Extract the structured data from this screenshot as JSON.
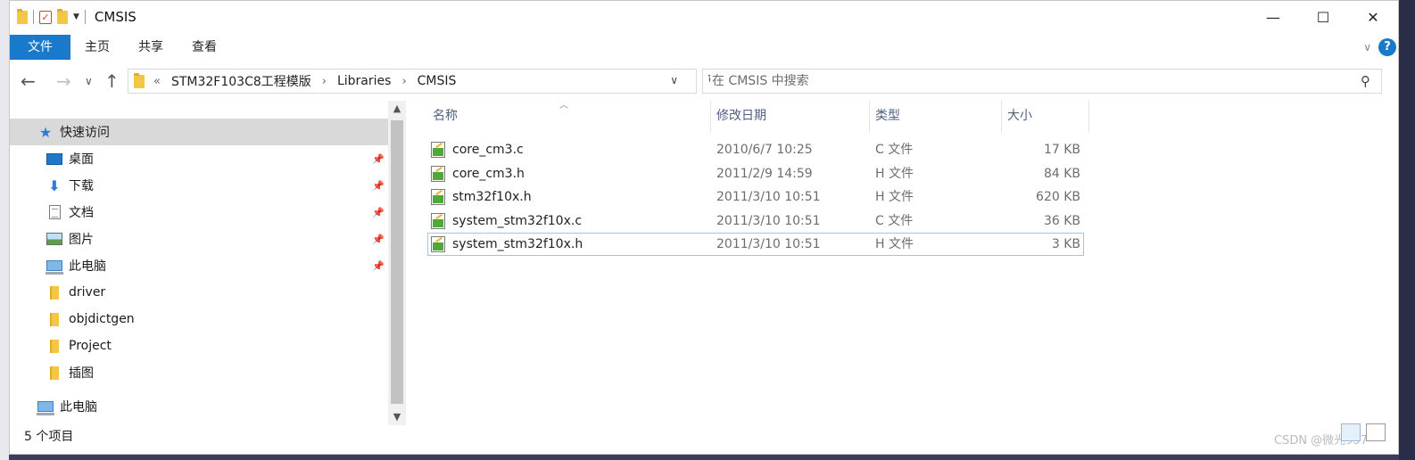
{
  "window": {
    "title": "CMSIS",
    "minimize": "—",
    "maximize": "☐",
    "close": "✕"
  },
  "ribbon": {
    "tabs": [
      "文件",
      "主页",
      "共享",
      "查看"
    ],
    "help": "?",
    "expand": "∨"
  },
  "nav": {
    "back": "←",
    "forward": "→",
    "recent": "∨",
    "up": "↑"
  },
  "address": {
    "prefix": "«",
    "crumbs": [
      "STM32F103C8工程模版",
      "Libraries",
      "CMSIS"
    ],
    "sep": "›",
    "dropdown": "∨",
    "refresh": "↻"
  },
  "search": {
    "placeholder": "在 CMSIS 中搜索",
    "value": "",
    "icon": "search-icon"
  },
  "sidebar": {
    "items": [
      {
        "label": "快速访问",
        "icon": "star-icon",
        "pinned": false
      },
      {
        "label": "桌面",
        "icon": "desktop-icon",
        "pinned": true
      },
      {
        "label": "下载",
        "icon": "download-icon",
        "pinned": true
      },
      {
        "label": "文档",
        "icon": "document-icon",
        "pinned": true
      },
      {
        "label": "图片",
        "icon": "pictures-icon",
        "pinned": true
      },
      {
        "label": "此电脑",
        "icon": "computer-icon",
        "pinned": true
      },
      {
        "label": "driver",
        "icon": "folder-icon",
        "pinned": false
      },
      {
        "label": "objdictgen",
        "icon": "folder-icon",
        "pinned": false
      },
      {
        "label": "Project",
        "icon": "folder-icon",
        "pinned": false
      },
      {
        "label": "插图",
        "icon": "folder-icon",
        "pinned": false
      },
      {
        "label": "此电脑",
        "icon": "computer-icon",
        "pinned": false
      }
    ],
    "pin_glyph": "📌"
  },
  "filelist": {
    "columns": [
      "名称",
      "修改日期",
      "类型",
      "大小"
    ],
    "sort_glyph": "︿",
    "rows": [
      {
        "name": "core_cm3.c",
        "date": "2010/6/7 10:25",
        "type": "C 文件",
        "size": "17 KB"
      },
      {
        "name": "core_cm3.h",
        "date": "2011/2/9 14:59",
        "type": "H 文件",
        "size": "84 KB"
      },
      {
        "name": "stm32f10x.h",
        "date": "2011/3/10 10:51",
        "type": "H 文件",
        "size": "620 KB"
      },
      {
        "name": "system_stm32f10x.c",
        "date": "2011/3/10 10:51",
        "type": "C 文件",
        "size": "36 KB"
      },
      {
        "name": "system_stm32f10x.h",
        "date": "2011/3/10 10:51",
        "type": "H 文件",
        "size": "3 KB"
      }
    ]
  },
  "status": {
    "count": "5 个项目"
  },
  "watermark": "CSDN @微光957",
  "colors": {
    "accent": "#1979ca",
    "selected_bg": "#d9d9d9",
    "header_text": "#4d6082"
  }
}
